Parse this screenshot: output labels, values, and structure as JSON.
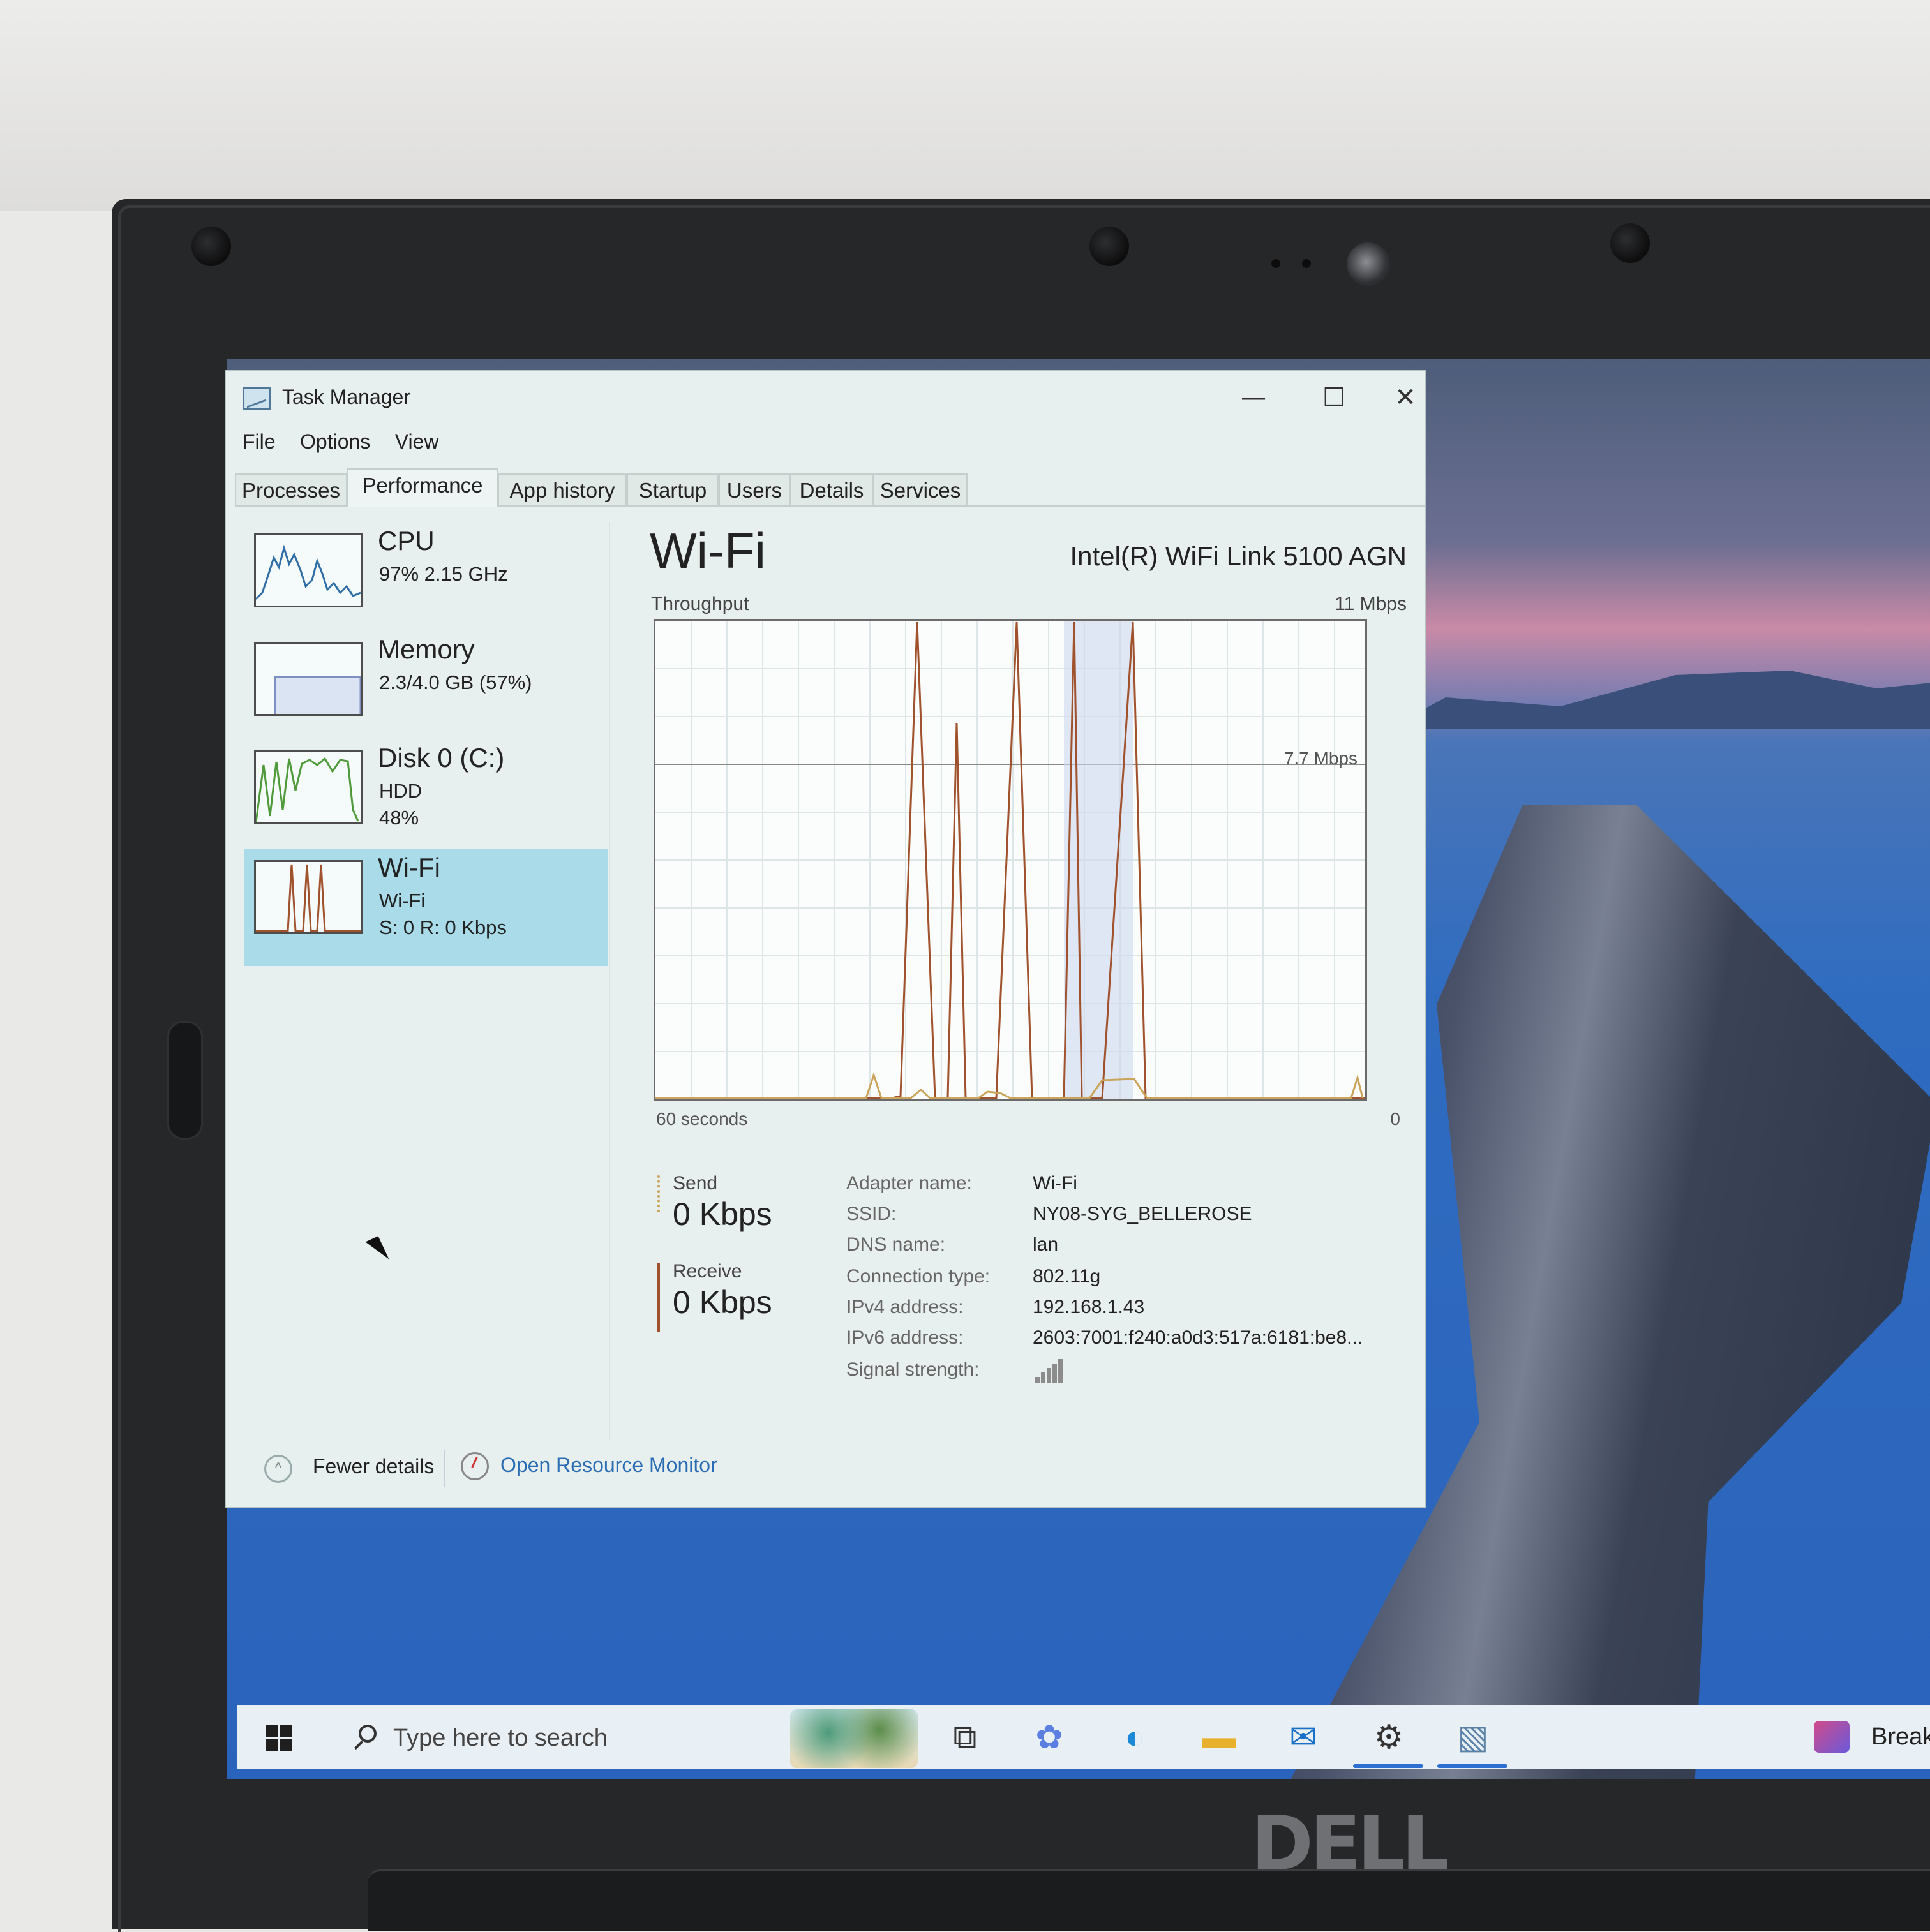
{
  "window": {
    "title": "Task Manager",
    "minimize": "—",
    "maximize": "☐",
    "close": "✕"
  },
  "menu": [
    "File",
    "Options",
    "View"
  ],
  "tabs": [
    "Processes",
    "Performance",
    "App history",
    "Startup",
    "Users",
    "Details",
    "Services"
  ],
  "active_tab": "Performance",
  "sidebar": [
    {
      "name": "CPU",
      "sub1": "97%  2.15 GHz",
      "sub2": ""
    },
    {
      "name": "Memory",
      "sub1": "2.3/4.0 GB (57%)",
      "sub2": ""
    },
    {
      "name": "Disk 0 (C:)",
      "sub1": "HDD",
      "sub2": "48%"
    },
    {
      "name": "Wi-Fi",
      "sub1": "Wi-Fi",
      "sub2": "S: 0 R: 0 Kbps"
    }
  ],
  "selected_item": "Wi-Fi",
  "main": {
    "title": "Wi-Fi",
    "adapter_model": "Intel(R) WiFi Link 5100 AGN",
    "throughput_label": "Throughput",
    "max_label": "11 Mbps",
    "mid_label": "7.7 Mbps",
    "x_left": "60 seconds",
    "x_right": "0",
    "send_label": "Send",
    "send_value": "0 Kbps",
    "receive_label": "Receive",
    "receive_value": "0 Kbps",
    "details": [
      {
        "key": "Adapter name:",
        "value": "Wi-Fi"
      },
      {
        "key": "SSID:",
        "value": "NY08-SYG_BELLEROSE"
      },
      {
        "key": "DNS name:",
        "value": "lan"
      },
      {
        "key": "Connection type:",
        "value": "802.11g"
      },
      {
        "key": "IPv4 address:",
        "value": "192.168.1.43"
      },
      {
        "key": "IPv6 address:",
        "value": "2603:7001:f240:a0d3:517a:6181:be8..."
      },
      {
        "key": "Signal strength:",
        "value": ""
      }
    ]
  },
  "footer": {
    "fewer_details": "Fewer details",
    "open_resource_monitor": "Open Resource Monitor"
  },
  "taskbar": {
    "search_placeholder": "Type here to search",
    "right_label": "Break"
  },
  "brand": "DELL",
  "colors": {
    "selected_bg": "#a9dbe9",
    "link": "#2a6cb3",
    "receive_line": "#a0522d",
    "send_line": "#c9a45a"
  }
}
